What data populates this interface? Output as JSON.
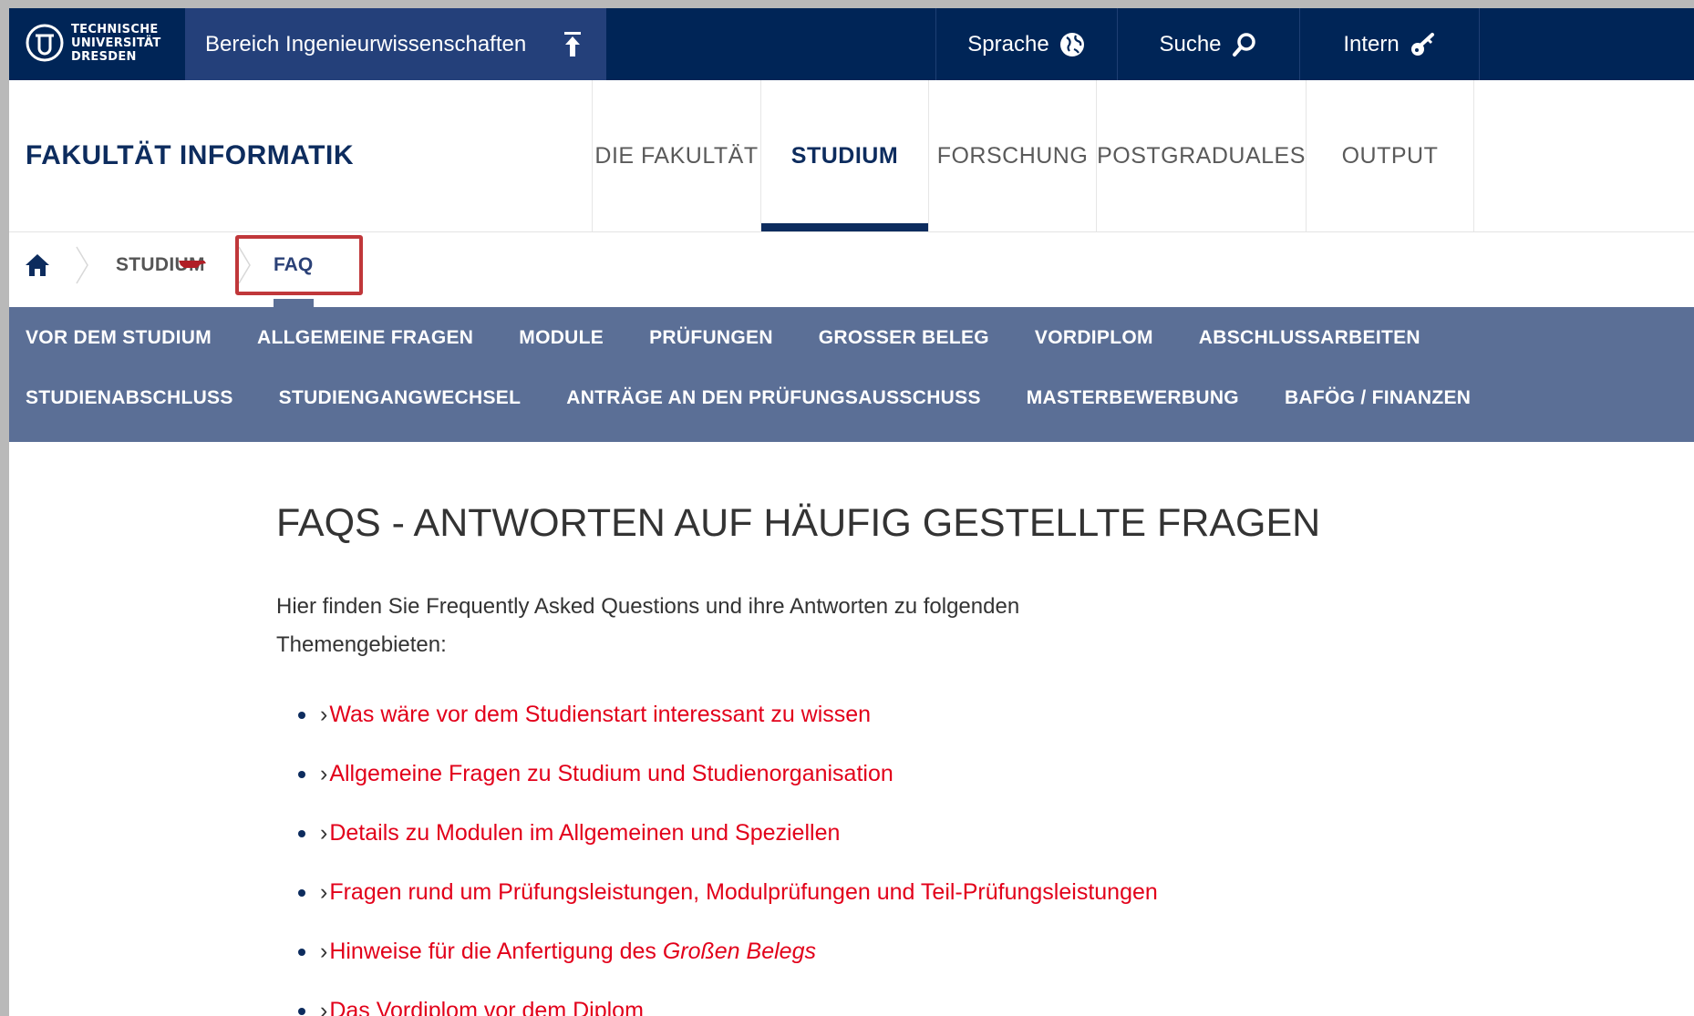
{
  "topbar": {
    "logo_lines": [
      "TECHNISCHE",
      "UNIVERSITÄT",
      "DRESDEN"
    ],
    "area_label": "Bereich Ingenieurwissenschaften",
    "nav": [
      {
        "label": "Sprache",
        "icon": "globe-icon"
      },
      {
        "label": "Suche",
        "icon": "search-icon"
      },
      {
        "label": "Intern",
        "icon": "key-icon"
      }
    ]
  },
  "header": {
    "faculty_title": "FAKULTÄT INFORMATIK",
    "main_nav": [
      "DIE FAKULTÄT",
      "STUDIUM",
      "FORSCHUNG",
      "POSTGRADUALES",
      "OUTPUT"
    ],
    "active_nav": "STUDIUM"
  },
  "breadcrumb": {
    "items": [
      "STUDIUM",
      "FAQ"
    ]
  },
  "subnav": {
    "row1": [
      "VOR DEM STUDIUM",
      "ALLGEMEINE FRAGEN",
      "MODULE",
      "PRÜFUNGEN",
      "GROSSER BELEG",
      "VORDIPLOM",
      "ABSCHLUSSARBEITEN"
    ],
    "row2": [
      "STUDIENABSCHLUSS",
      "STUDIENGANGWECHSEL",
      "ANTRÄGE AN DEN PRÜFUNGSAUSSCHUSS",
      "MASTERBEWERBUNG",
      "BAFÖG / FINANZEN"
    ]
  },
  "content": {
    "title": "FAQS - ANTWORTEN AUF HÄUFIG GESTELLTE FRAGEN",
    "intro": "Hier finden Sie Frequently Asked Questions und ihre Antworten zu folgenden Themengebieten:",
    "links": [
      "Was wäre vor dem Studienstart interessant zu wissen",
      "Allgemeine Fragen zu Studium und Studienorganisation",
      "Details zu Modulen im Allgemeinen und Speziellen",
      "Fragen rund um Prüfungsleistungen, Modulprüfungen und Teil-Prüfungsleistungen",
      "Hinweise für die Anfertigung des",
      "Großen Belegs",
      "Das Vordiplom vor dem Diplom"
    ]
  },
  "colors": {
    "topbar": "#002557",
    "area": "#24407a",
    "subnav": "#5b6f96",
    "link": "#e2001a",
    "highlight": "#c0373a"
  }
}
